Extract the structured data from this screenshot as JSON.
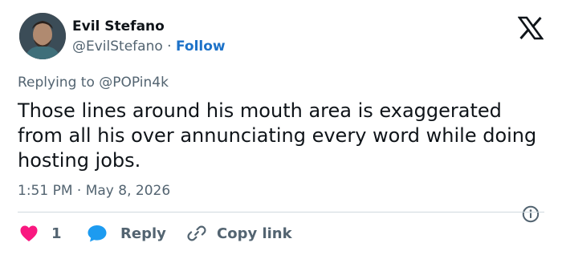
{
  "author": {
    "display_name": "Evil Stefano",
    "handle": "@EvilStefano",
    "separator": " · ",
    "follow_label": "Follow"
  },
  "tweet": {
    "replying_prefix": "Replying to ",
    "replying_to": "@POPin4k",
    "text": "Those lines around his mouth area is exaggerated from all his over annunciating every word while doing hosting jobs.",
    "timestamp": "1:51 PM · May 8, 2026"
  },
  "actions": {
    "like_count": "1",
    "reply_label": "Reply",
    "copy_label": "Copy link"
  },
  "icons": {
    "logo": "x-logo-icon",
    "info": "info-icon",
    "like": "heart-icon",
    "reply": "speech-bubble-icon",
    "copy": "link-icon"
  },
  "colors": {
    "accent": "#1d72c8",
    "heart": "#f91880",
    "reply_bubble": "#1d9bf0",
    "muted_text": "#536471",
    "primary_text": "#0f1419"
  }
}
